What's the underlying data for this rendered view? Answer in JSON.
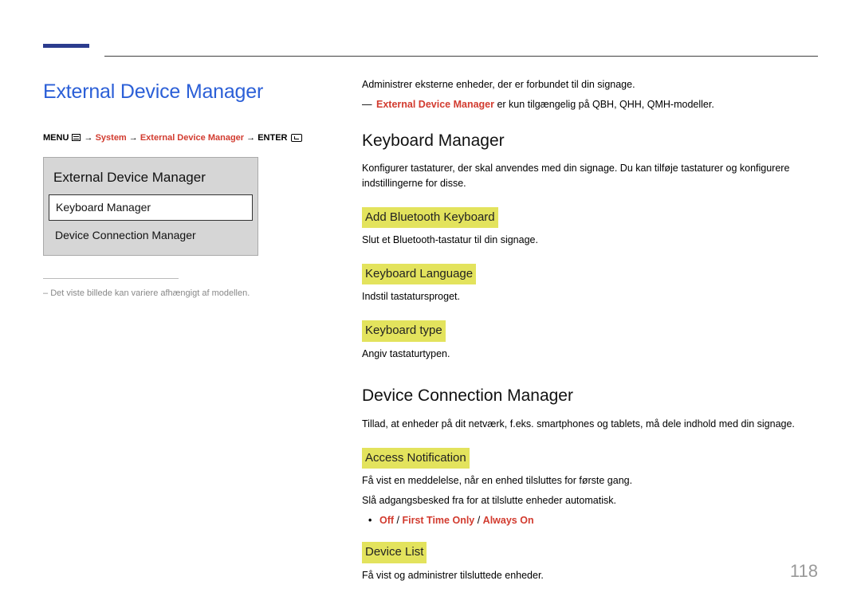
{
  "page_title": "External Device Manager",
  "breadcrumb": {
    "menu": "MENU",
    "arrow": "→",
    "system": "System",
    "edm": "External Device Manager",
    "enter": "ENTER"
  },
  "menu_panel": {
    "title": "External Device Manager",
    "item_selected": "Keyboard Manager",
    "item_2": "Device Connection Manager"
  },
  "left_note": "Det viste billede kan variere afhængigt af modellen.",
  "intro": "Administrer eksterne enheder, der er forbundet til din signage.",
  "availability_note_prefix": "External Device Manager",
  "availability_note_rest": " er kun tilgængelig på QBH, QHH, QMH-modeller.",
  "sections": {
    "keyboard_manager": {
      "heading": "Keyboard Manager",
      "desc": "Konfigurer tastaturer, der skal anvendes med din signage. Du kan tilføje tastaturer og konfigurere indstillingerne for disse.",
      "add_bt": {
        "heading": "Add Bluetooth Keyboard",
        "desc": "Slut et Bluetooth-tastatur til din signage."
      },
      "lang": {
        "heading": "Keyboard Language",
        "desc": "Indstil tastatursproget."
      },
      "type": {
        "heading": "Keyboard type",
        "desc": "Angiv tastaturtypen."
      }
    },
    "dcm": {
      "heading": "Device Connection Manager",
      "desc": "Tillad, at enheder på dit netværk, f.eks. smartphones og tablets, må dele indhold med din signage.",
      "access": {
        "heading": "Access Notification",
        "desc1": "Få vist en meddelelse, når en enhed tilsluttes for første gang.",
        "desc2": "Slå adgangsbesked fra for at tilslutte enheder automatisk.",
        "options": {
          "off": "Off",
          "first": "First Time Only",
          "always": "Always On",
          "sep": " / "
        }
      },
      "list": {
        "heading": "Device List",
        "desc": "Få vist og administrer tilsluttede enheder."
      }
    }
  },
  "page_number": "118"
}
